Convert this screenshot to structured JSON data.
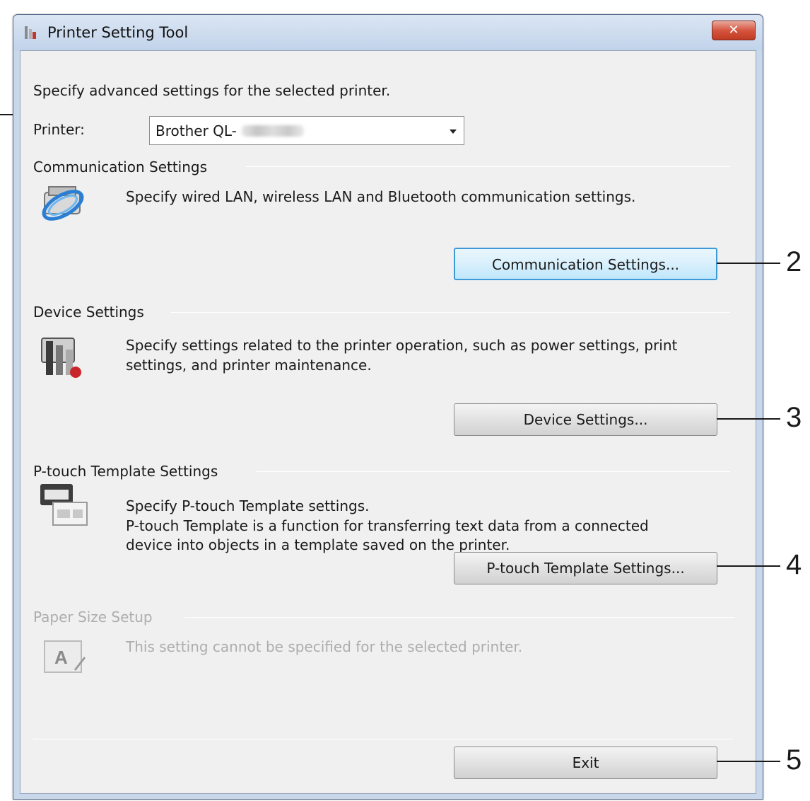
{
  "window": {
    "title": "Printer Setting Tool",
    "close_glyph": "✕"
  },
  "intro_text": "Specify advanced settings for the selected printer.",
  "printer": {
    "label": "Printer:",
    "selected_value": "Brother QL-"
  },
  "communication": {
    "heading": "Communication Settings",
    "description": "Specify wired LAN, wireless LAN and Bluetooth communication settings.",
    "button_label": "Communication Settings...",
    "icon": "network-printer-icon"
  },
  "device": {
    "heading": "Device Settings",
    "description_line1": "Specify settings related to the printer operation, such as power settings, print",
    "description_line2": "settings, and printer maintenance.",
    "button_label": "Device Settings...",
    "icon": "device-settings-icon"
  },
  "ptouch": {
    "heading": "P-touch Template Settings",
    "description_line1": "Specify P-touch Template settings.",
    "description_line2": "P-touch Template is a function for transferring text data from a connected",
    "description_line3": "device into objects in a template saved on the printer.",
    "button_label": "P-touch Template Settings...",
    "icon": "template-printer-icon"
  },
  "paper": {
    "heading": "Paper Size Setup",
    "description": "This setting cannot be specified for the selected printer.",
    "icon": "paper-size-icon"
  },
  "exit_label": "Exit",
  "callouts": [
    "2",
    "3",
    "4",
    "5"
  ],
  "colors": {
    "focus_border": "#3c9bd6",
    "close_red": "#c23a22",
    "disabled_text": "#adadad"
  }
}
